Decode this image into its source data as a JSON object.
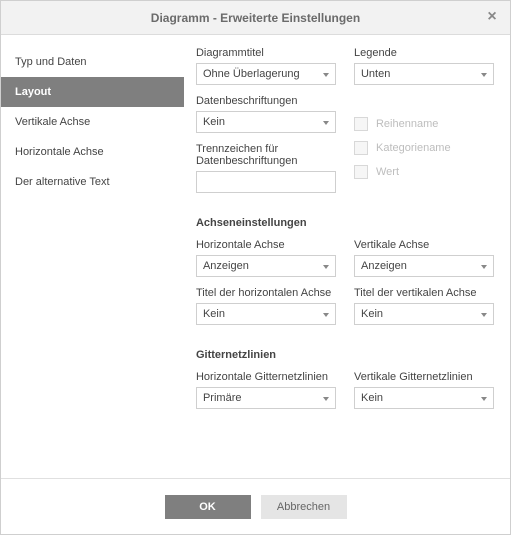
{
  "dialog": {
    "title": "Diagramm - Erweiterte Einstellungen"
  },
  "sidebar": {
    "items": [
      {
        "label": "Typ und Daten",
        "active": false
      },
      {
        "label": "Layout",
        "active": true
      },
      {
        "label": "Vertikale Achse",
        "active": false
      },
      {
        "label": "Horizontale Achse",
        "active": false
      },
      {
        "label": "Der alternative Text",
        "active": false
      }
    ]
  },
  "layout": {
    "chartTitle": {
      "label": "Diagrammtitel",
      "value": "Ohne Überlagerung"
    },
    "legend": {
      "label": "Legende",
      "value": "Unten"
    },
    "dataLabels": {
      "label": "Datenbeschriftungen",
      "value": "Kein"
    },
    "separator": {
      "label": "Trennzeichen für Datenbeschriftungen",
      "value": ""
    },
    "checks": {
      "seriesName": "Reihenname",
      "categoryName": "Kategoriename",
      "value": "Wert"
    }
  },
  "axis": {
    "sectionTitle": "Achseneinstellungen",
    "horizontal": {
      "label": "Horizontale Achse",
      "value": "Anzeigen"
    },
    "vertical": {
      "label": "Vertikale Achse",
      "value": "Anzeigen"
    },
    "hTitle": {
      "label": "Titel der horizontalen Achse",
      "value": "Kein"
    },
    "vTitle": {
      "label": "Titel der vertikalen Achse",
      "value": "Kein"
    }
  },
  "grid": {
    "sectionTitle": "Gitternetzlinien",
    "horizontal": {
      "label": "Horizontale Gitternetzlinien",
      "value": "Primäre"
    },
    "vertical": {
      "label": "Vertikale Gitternetzlinien",
      "value": "Kein"
    }
  },
  "footer": {
    "ok": "OK",
    "cancel": "Abbrechen"
  }
}
